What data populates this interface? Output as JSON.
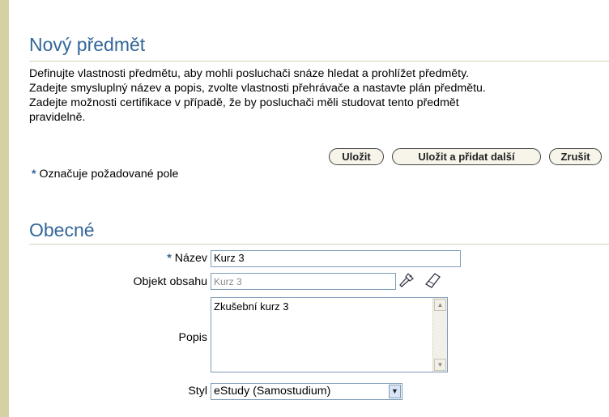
{
  "page": {
    "title": "Nový předmět",
    "intro_lines": [
      "Definujte vlastnosti předmětu, aby mohli posluchači snáze hledat a prohlížet předměty.",
      "Zadejte smysluplný název a popis, zvolte vlastnosti přehrávače a nastavte plán předmětu.",
      "Zadejte možnosti certifikace v případě, že by posluchači měli studovat tento předmět",
      "pravidelně."
    ]
  },
  "buttons": {
    "save": "Uložit",
    "save_add": "Uložit a přidat další",
    "cancel": "Zrušit"
  },
  "required_note": {
    "star": "*",
    "text": "Označuje požadované pole"
  },
  "section": {
    "title": "Obecné"
  },
  "form": {
    "name_label": "Název",
    "name_value": "Kurz 3",
    "content_label": "Objekt obsahu",
    "content_value": "Kurz 3",
    "description_label": "Popis",
    "description_value": "Zkušební kurz 3",
    "style_label": "Styl",
    "style_value": "eStudy (Samostudium)"
  },
  "icons": {
    "search": "flashlight-search-icon",
    "clear": "eraser-clear-icon"
  },
  "colors": {
    "accent": "#336699",
    "sidebar": "#d6d1a4",
    "rule": "#d7d3b4"
  }
}
